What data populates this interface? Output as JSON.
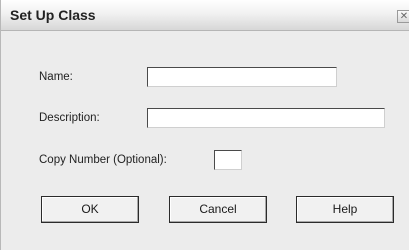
{
  "window": {
    "title": "Set Up Class",
    "close_icon": "close-icon"
  },
  "form": {
    "name_label": "Name:",
    "name_value": "",
    "description_label": "Description:",
    "description_value": "",
    "copy_number_label": "Copy Number (Optional):",
    "copy_number_value": ""
  },
  "buttons": {
    "ok": "OK",
    "cancel": "Cancel",
    "help": "Help"
  }
}
